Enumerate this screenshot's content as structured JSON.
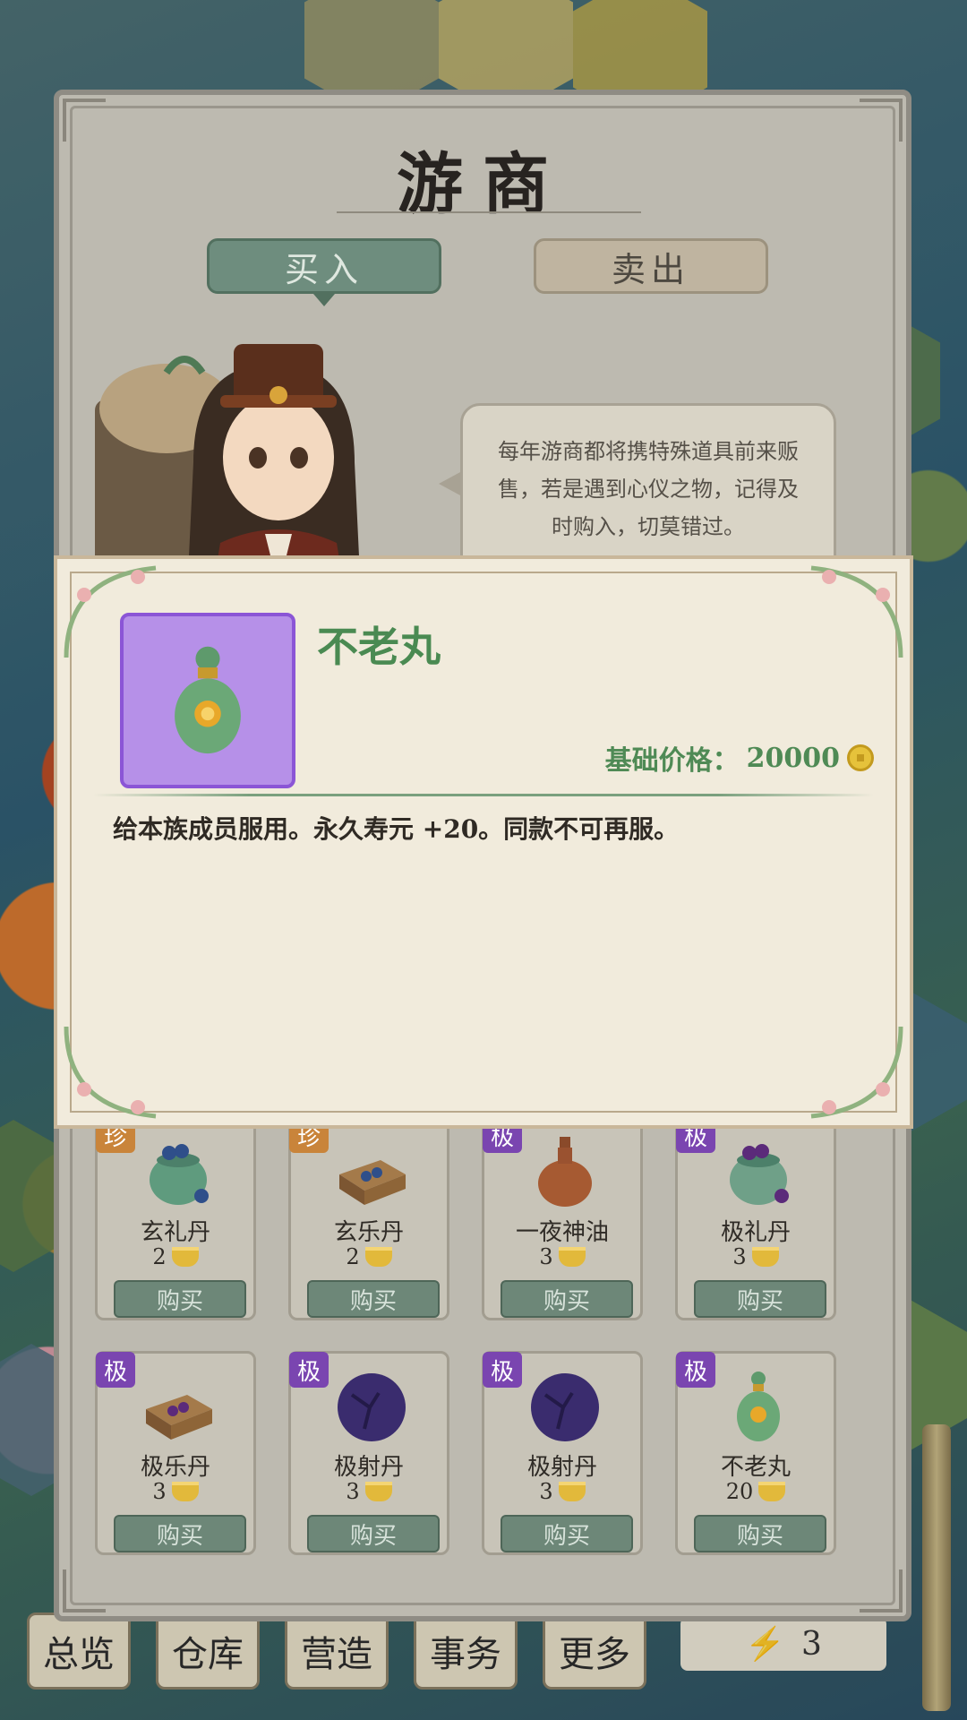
{
  "window": {
    "title": "游商",
    "tabs": {
      "buy": "买入",
      "sell": "卖出",
      "active": "buy"
    },
    "merchant_dialog": "每年游商都将携特殊道具前来贩售，若是遇到心仪之物，记得及时购入，切莫错过。"
  },
  "detail": {
    "item_name": "不老丸",
    "price_label": "基础价格：",
    "price_value": "20000",
    "currency_icon": "copper-coin-icon",
    "description": "给本族成员服用。永久寿元 +20。同款不可再服。",
    "rarity_color": "#b690e8"
  },
  "items": [
    {
      "badge": "珍",
      "rarity": "zhen",
      "name": "玄礼丹",
      "price": "2",
      "buy_label": "购买",
      "icon": "jade-jar-blue-pills-icon"
    },
    {
      "badge": "珍",
      "rarity": "zhen",
      "name": "玄乐丹",
      "price": "2",
      "buy_label": "购买",
      "icon": "wooden-box-blue-pills-icon"
    },
    {
      "badge": "极",
      "rarity": "ji",
      "name": "一夜神油",
      "price": "3",
      "buy_label": "购买",
      "icon": "clay-bottle-icon"
    },
    {
      "badge": "极",
      "rarity": "ji",
      "name": "极礼丹",
      "price": "3",
      "buy_label": "购买",
      "icon": "jade-jar-purple-pills-icon"
    },
    {
      "badge": "极",
      "rarity": "ji",
      "name": "极乐丹",
      "price": "3",
      "buy_label": "购买",
      "icon": "wooden-box-purple-pills-icon"
    },
    {
      "badge": "极",
      "rarity": "ji",
      "name": "极射丹",
      "price": "3",
      "buy_label": "购买",
      "icon": "purple-orb-icon"
    },
    {
      "badge": "极",
      "rarity": "ji",
      "name": "极射丹",
      "price": "3",
      "buy_label": "购买",
      "icon": "purple-orb-icon"
    },
    {
      "badge": "极",
      "rarity": "ji",
      "name": "不老丸",
      "price": "20",
      "buy_label": "购买",
      "icon": "green-gourd-bottle-icon"
    }
  ],
  "currency": {
    "icon": "gold-ingot-icon"
  },
  "bottom_nav": [
    "总览",
    "仓库",
    "营造",
    "事务",
    "更多"
  ],
  "energy": {
    "icon": "lightning-icon",
    "value": "3"
  },
  "colors": {
    "buy_tab": "#6e8d7e",
    "buy_button": "#6d8778",
    "badge_zhen": "#c9843a",
    "badge_ji": "#7a45b0",
    "title_green": "#4a8a52"
  }
}
